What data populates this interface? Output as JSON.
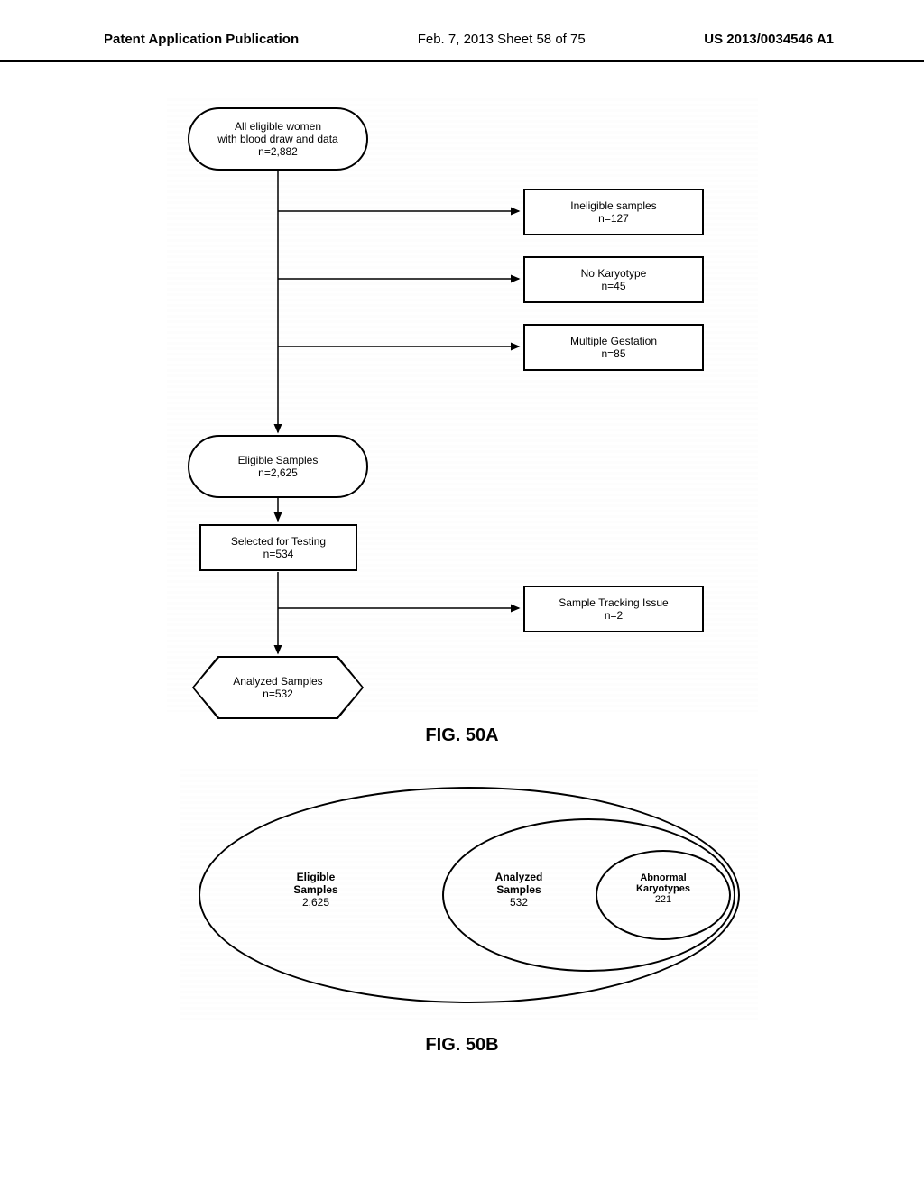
{
  "header": {
    "left": "Patent Application Publication",
    "center": "Feb. 7, 2013  Sheet 58 of 75",
    "right": "US 2013/0034546 A1"
  },
  "flowchart": {
    "start": {
      "line1": "All eligible women",
      "line2": "with blood draw and data",
      "value": "n=2,882"
    },
    "ineligible": {
      "title": "Ineligible samples",
      "value": "n=127"
    },
    "nokaryotype": {
      "title": "No Karyotype",
      "value": "n=45"
    },
    "multiple": {
      "title": "Multiple Gestation",
      "value": "n=85"
    },
    "eligible": {
      "title": "Eligible Samples",
      "value": "n=2,625"
    },
    "selected": {
      "title": "Selected for Testing",
      "value": "n=534"
    },
    "tracking": {
      "title": "Sample Tracking Issue",
      "value": "n=2"
    },
    "analyzed": {
      "title": "Analyzed Samples",
      "value": "n=532"
    }
  },
  "figLabelA": "FIG. 50A",
  "venn": {
    "eligible": {
      "title": "Eligible",
      "subtitle": "Samples",
      "value": "2,625"
    },
    "analyzed": {
      "title": "Analyzed",
      "subtitle": "Samples",
      "value": "532"
    },
    "abnormal": {
      "title": "Abnormal",
      "subtitle": "Karyotypes",
      "value": "221"
    }
  },
  "figLabelB": "FIG. 50B"
}
